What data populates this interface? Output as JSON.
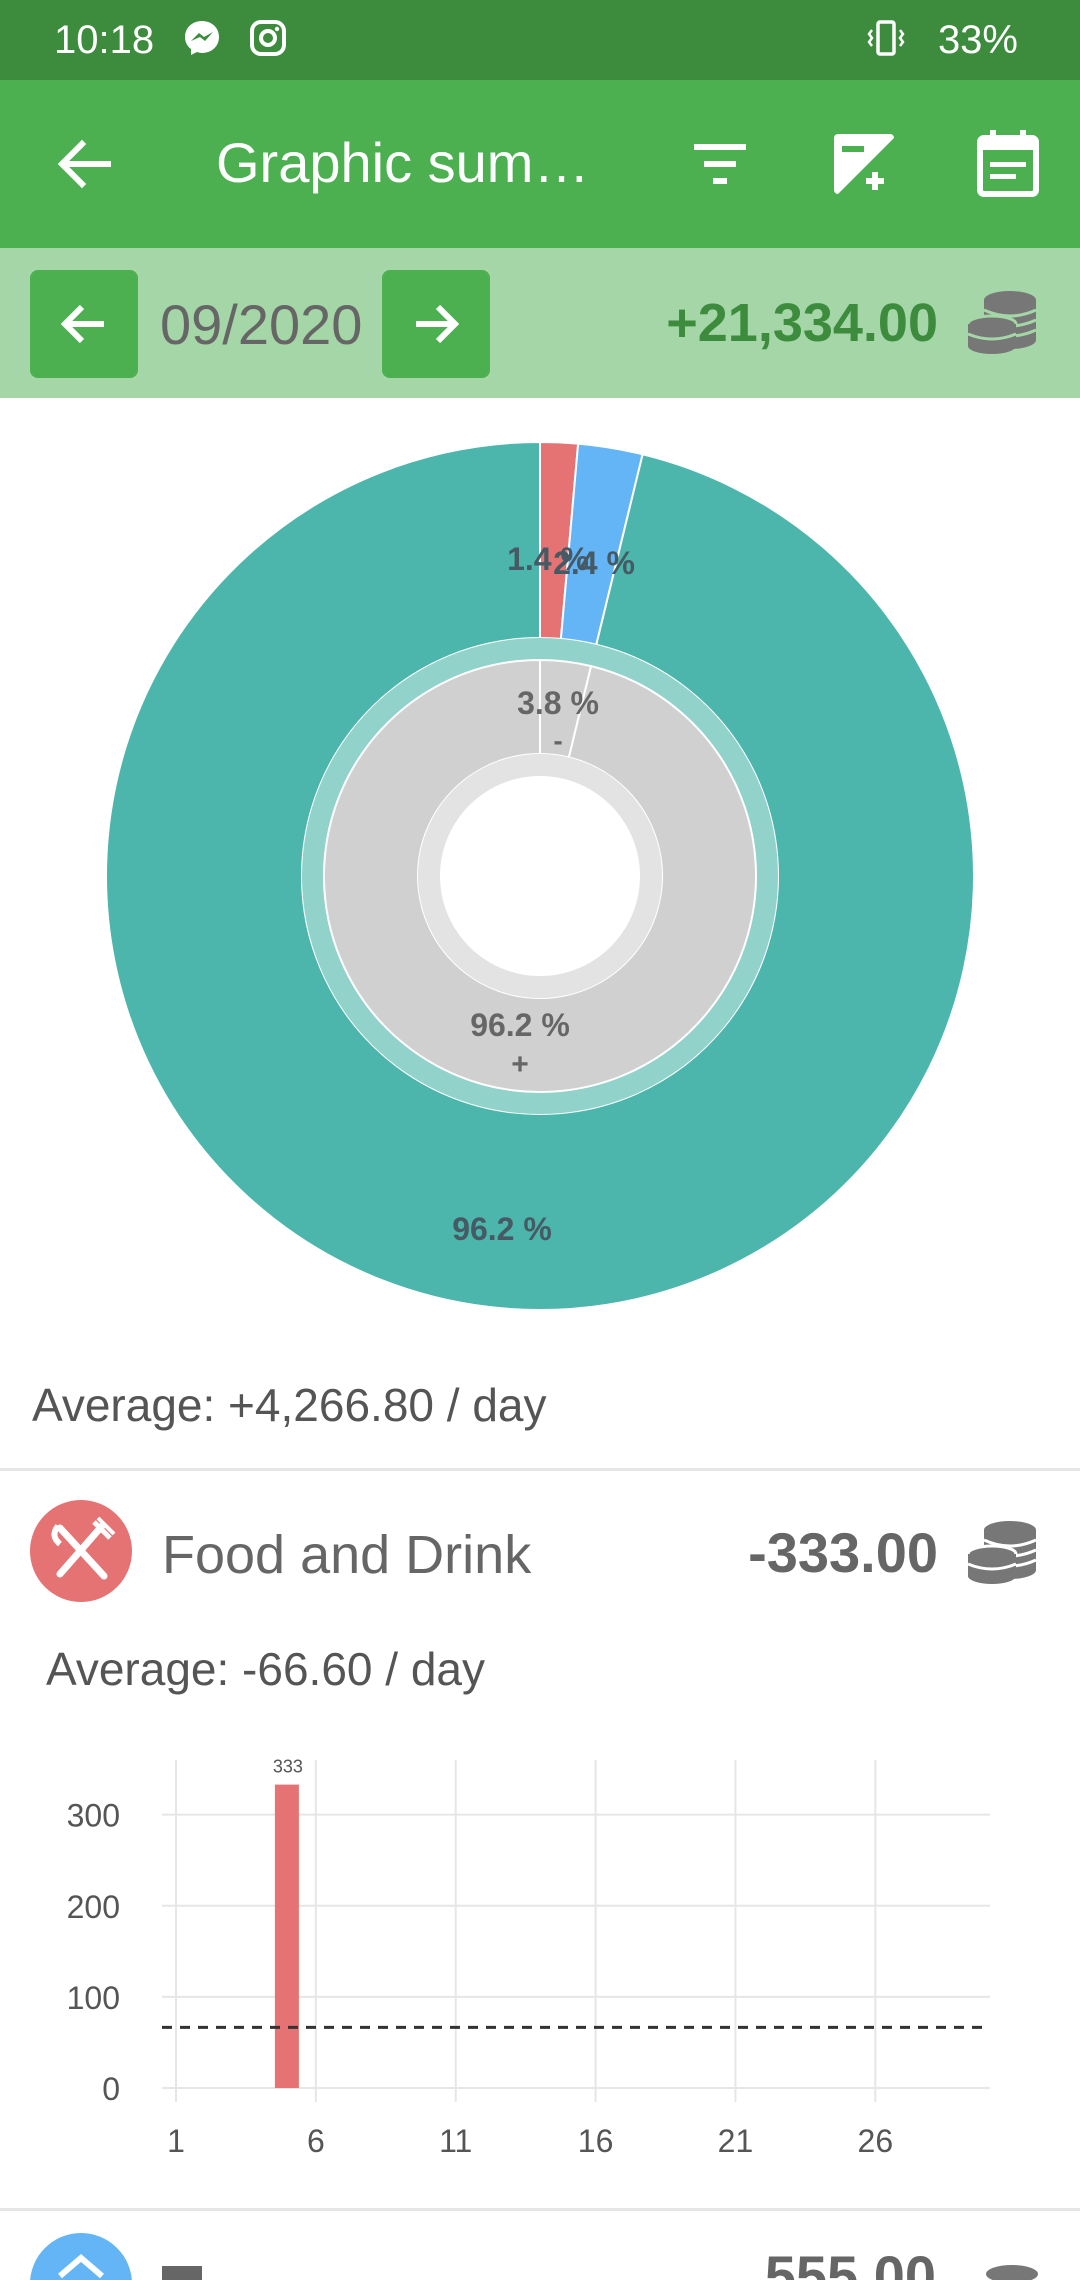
{
  "status_bar": {
    "time": "10:18",
    "battery": "33%",
    "icons": [
      "messenger-icon",
      "instagram-icon",
      "vibrate-icon"
    ]
  },
  "app_bar": {
    "title": "Graphic summ…",
    "icons": [
      "back-arrow-icon",
      "filter-icon",
      "exposure-add-icon",
      "calendar-icon"
    ]
  },
  "period": {
    "label": "09/2020",
    "total": "+21,334.00",
    "icons": [
      "prev-arrow-icon",
      "next-arrow-icon",
      "coins-icon"
    ]
  },
  "summary": {
    "average": "Average: +4,266.80 / day"
  },
  "category": {
    "name": "Food and Drink",
    "total": "-333.00",
    "average": "Average: -66.60 / day",
    "icon": "fork-knife-icon",
    "color": "#e57373"
  },
  "next_category": {
    "total_partial": "555.00",
    "color": "#64b5f6"
  },
  "chart_data": [
    {
      "type": "pie",
      "description": "outer ring by category",
      "slices": [
        {
          "value": 1.4,
          "label": "1.4 %",
          "color": "#e57373"
        },
        {
          "value": 2.4,
          "label": "2.4 %",
          "color": "#64b5f6"
        },
        {
          "value": 96.2,
          "label": "96.2 %",
          "color": "#4db6ac"
        }
      ]
    },
    {
      "type": "pie",
      "description": "inner ring expense vs income",
      "slices": [
        {
          "value": 3.8,
          "label": "3.8 %",
          "sign": "-",
          "color": "#d0d0d0"
        },
        {
          "value": 96.2,
          "label": "96.2 %",
          "sign": "+",
          "color": "#d0d0d0"
        }
      ]
    },
    {
      "type": "bar",
      "x_ticks": [
        "1",
        "6",
        "11",
        "16",
        "21",
        "26"
      ],
      "y_ticks": [
        "0",
        "100",
        "200",
        "300"
      ],
      "ylim": [
        0,
        360
      ],
      "xlim": [
        0,
        30
      ],
      "grid": true,
      "bars": [
        {
          "x": 5,
          "value": 333,
          "label": "333",
          "color": "#e57373"
        }
      ],
      "average_line": 66.6
    }
  ]
}
